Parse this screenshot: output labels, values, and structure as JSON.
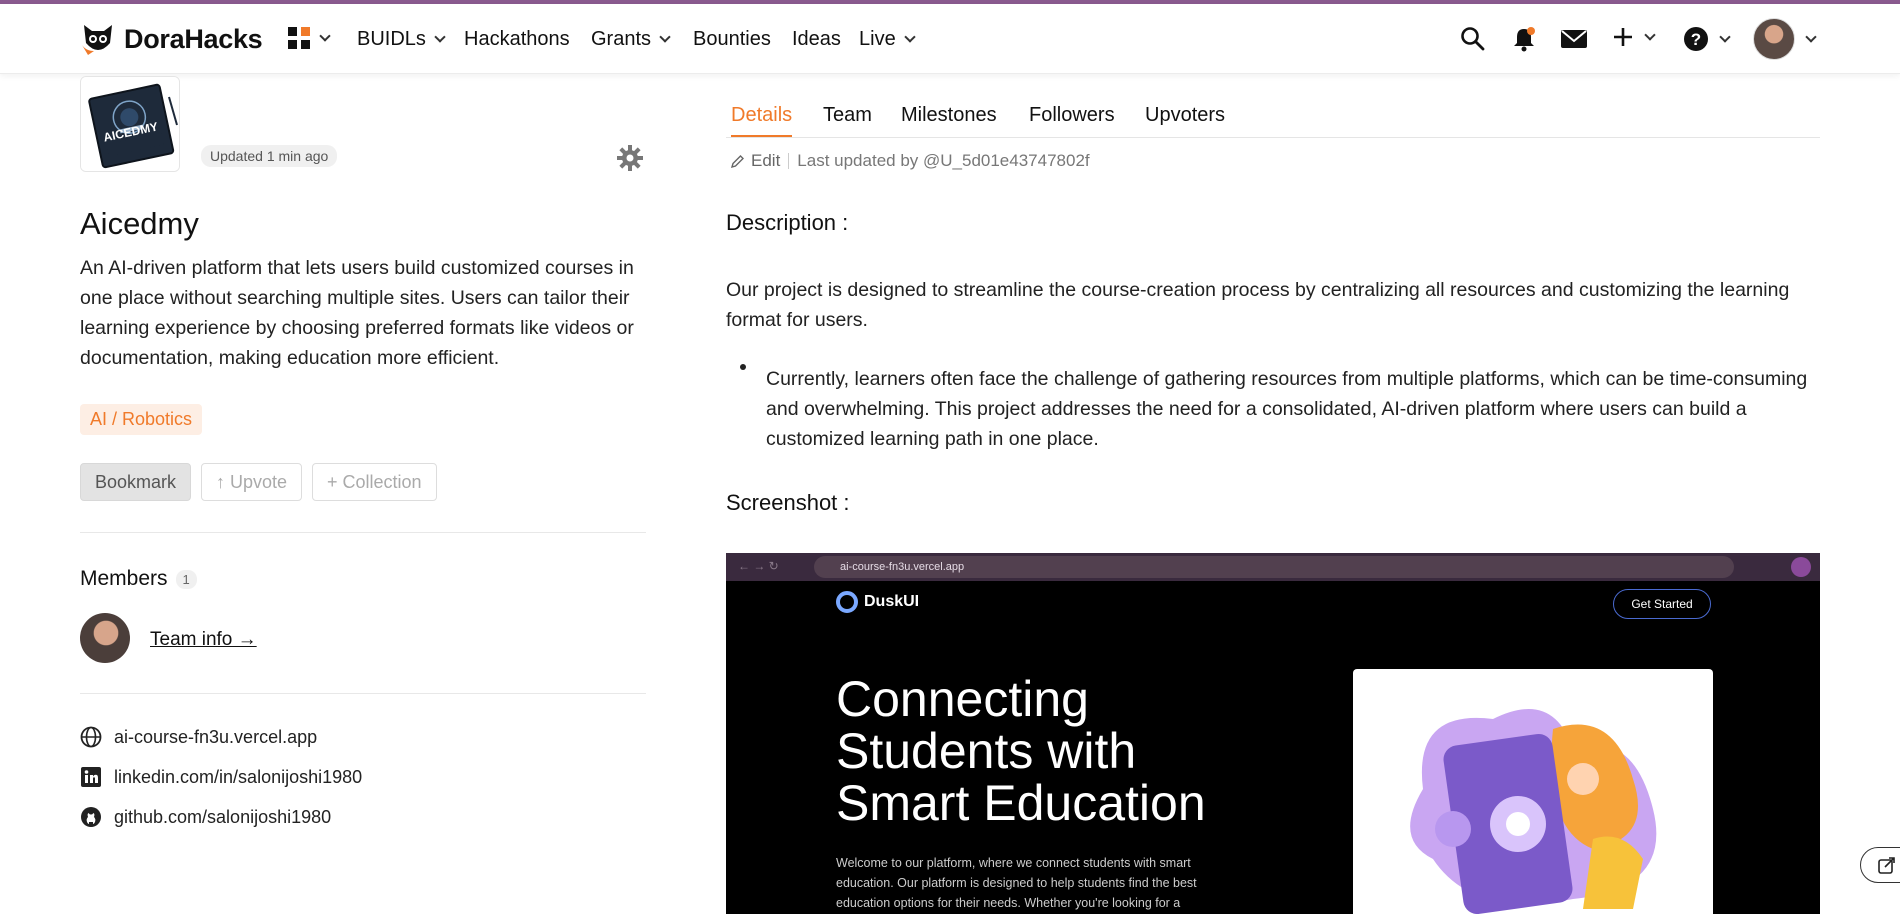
{
  "nav": {
    "brand": "DoraHacks",
    "items": [
      {
        "label": "BUIDLs",
        "has_chevron": true
      },
      {
        "label": "Hackathons",
        "has_chevron": false
      },
      {
        "label": "Grants",
        "has_chevron": true
      },
      {
        "label": "Bounties",
        "has_chevron": false
      },
      {
        "label": "Ideas",
        "has_chevron": false
      },
      {
        "label": "Live",
        "has_chevron": true
      }
    ],
    "icons": [
      "apps-grid-icon",
      "search-icon",
      "bell-icon",
      "mail-icon",
      "plus-icon",
      "help-icon",
      "avatar"
    ]
  },
  "project": {
    "thumb_text": "AICEDMY",
    "updated": "Updated 1 min ago",
    "title": "Aicedmy",
    "description": "An AI-driven platform that lets users build customized courses in one place without searching multiple sites. Users can tailor their learning experience by choosing preferred formats like videos or documentation, making education more efficient.",
    "tag": "AI / Robotics",
    "buttons": {
      "bookmark": "Bookmark",
      "upvote": "↑ Upvote",
      "collection": "+ Collection"
    },
    "members_title": "Members",
    "members_count": "1",
    "team_info": "Team info →",
    "links": [
      {
        "icon": "globe-icon",
        "text": "ai-course-fn3u.vercel.app"
      },
      {
        "icon": "linkedin-icon",
        "text": "linkedin.com/in/salonijoshi1980"
      },
      {
        "icon": "github-icon",
        "text": "github.com/salonijoshi1980"
      }
    ]
  },
  "tabs": [
    {
      "label": "Details",
      "active": true
    },
    {
      "label": "Team",
      "active": false
    },
    {
      "label": "Milestones",
      "active": false
    },
    {
      "label": "Followers",
      "active": false
    },
    {
      "label": "Upvoters",
      "active": false
    }
  ],
  "details": {
    "edit": "Edit",
    "last_updated": "Last updated by @U_5d01e43747802f",
    "description_heading": "Description :",
    "description_para": "Our project is designed to streamline the course-creation process by centralizing all resources and customizing the learning format for users.",
    "bullet": "Currently, learners often face the challenge of gathering resources from multiple platforms, which can be time-consuming and overwhelming. This project addresses the need for a consolidated, AI-driven platform where users can build a customized learning path in one place.",
    "screenshot_heading": "Screenshot :"
  },
  "screenshot": {
    "url": "ai-course-fn3u.vercel.app",
    "brand": "DuskUI",
    "cta": "Get Started",
    "hero": "Connecting Students with Smart Education",
    "sub": "Welcome to our platform, where we connect students with smart education. Our platform is designed to help students find the best education options for their needs. Whether you're looking for a"
  },
  "colors": {
    "accent": "#f07a2a",
    "topstrip": "#8a5a8f",
    "browserbar": "#3a2a3e"
  }
}
